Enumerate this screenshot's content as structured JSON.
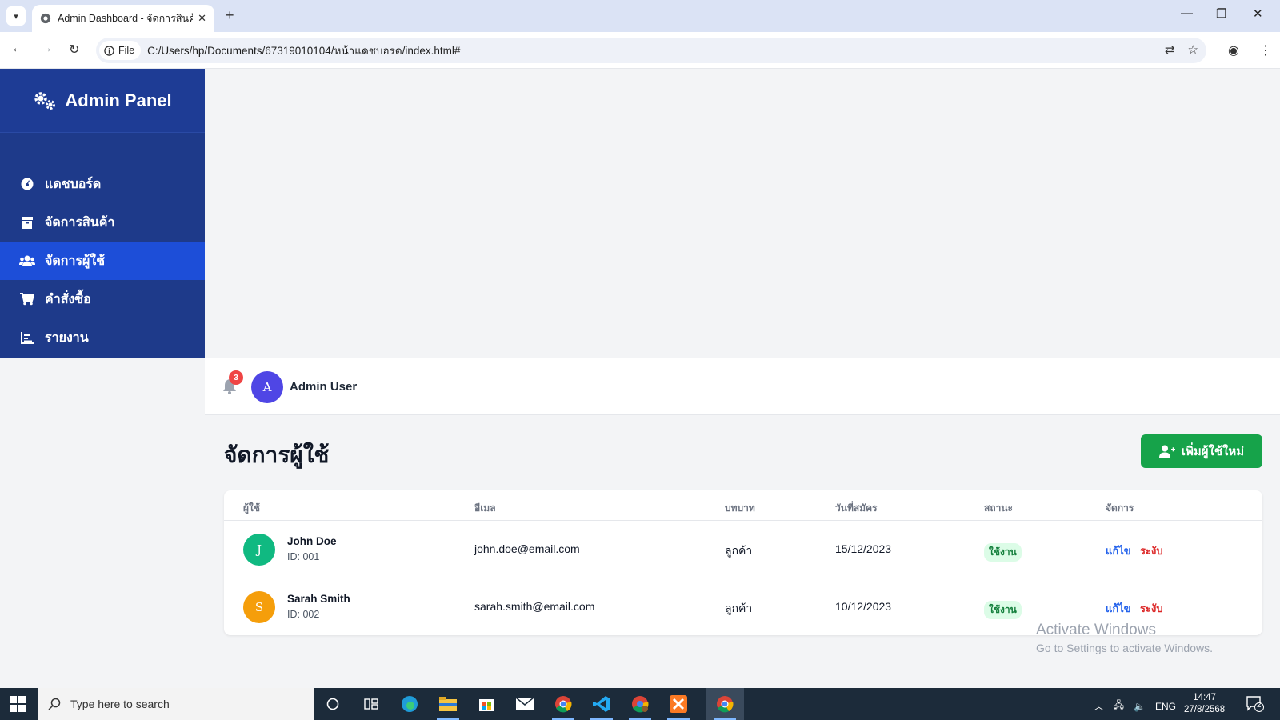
{
  "browser": {
    "tab_title": "Admin Dashboard - จัดการสินค้า",
    "url_chip": "File",
    "url": "C:/Users/hp/Documents/67319010104/หน้าแดชบอรด/index.html#"
  },
  "sidebar": {
    "brand": "Admin Panel",
    "items": [
      {
        "label": "แดชบอร์ด",
        "icon": "dashboard-icon",
        "active": false
      },
      {
        "label": "จัดการสินค้า",
        "icon": "box-icon",
        "active": false
      },
      {
        "label": "จัดการผู้ใช้",
        "icon": "users-icon",
        "active": true
      },
      {
        "label": "คำสั่งซื้อ",
        "icon": "cart-icon",
        "active": false
      },
      {
        "label": "รายงาน",
        "icon": "chart-icon",
        "active": false
      }
    ]
  },
  "header": {
    "notification_count": "3",
    "avatar_initial": "A",
    "user_name": "Admin User"
  },
  "page": {
    "title": "จัดการผู้ใช้",
    "add_button": "เพิ่มผู้ใช้ใหม่"
  },
  "table": {
    "headers": [
      "ผู้ใช้",
      "อีเมล",
      "บทบาท",
      "วันที่สมัคร",
      "สถานะ",
      "จัดการ"
    ],
    "rows": [
      {
        "initial": "J",
        "avatar_color": "#10b981",
        "name": "John Doe",
        "id": "ID: 001",
        "email": "john.doe@email.com",
        "role": "ลูกค้า",
        "date": "15/12/2023",
        "status": "ใช้งาน",
        "edit": "แก้ไข",
        "suspend": "ระงับ"
      },
      {
        "initial": "S",
        "avatar_color": "#f59e0b",
        "name": "Sarah Smith",
        "id": "ID: 002",
        "email": "sarah.smith@email.com",
        "role": "ลูกค้า",
        "date": "10/12/2023",
        "status": "ใช้งาน",
        "edit": "แก้ไข",
        "suspend": "ระงับ"
      }
    ]
  },
  "watermark": {
    "line1": "Activate Windows",
    "line2": "Go to Settings to activate Windows."
  },
  "taskbar": {
    "search_placeholder": "Type here to search",
    "lang": "ENG",
    "time": "14:47",
    "date": "27/8/2568",
    "notif_count": "2"
  },
  "colors": {
    "sidebar_bg": "#1e3a8a",
    "sidebar_active": "#1d4ed8",
    "add_button": "#16a34a",
    "badge": "#ef4444"
  }
}
